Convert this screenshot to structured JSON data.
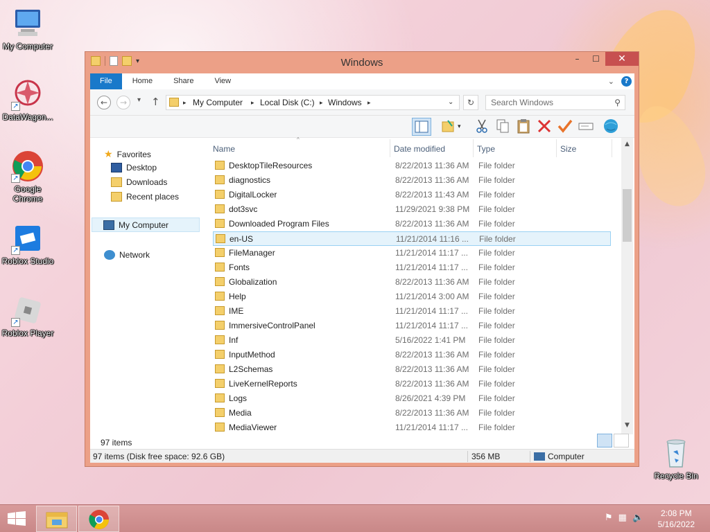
{
  "desktop": {
    "icons": [
      {
        "label": "My Computer"
      },
      {
        "label": "DataWagon..."
      },
      {
        "label": "Google Chrome"
      },
      {
        "label": "Roblox Studio"
      },
      {
        "label": "Roblox Player"
      },
      {
        "label": "Recycle Bin"
      }
    ]
  },
  "window": {
    "title": "Windows",
    "controls": {
      "minimize": "–",
      "maximize": "☐",
      "close": "✕"
    },
    "ribbon_tabs": [
      "File",
      "Home",
      "Share",
      "View"
    ],
    "address": {
      "segments": [
        "My Computer",
        "Local Disk (C:)",
        "Windows"
      ]
    },
    "search": {
      "placeholder": "Search Windows"
    },
    "nav": {
      "favorites": "Favorites",
      "favorites_items": [
        "Desktop",
        "Downloads",
        "Recent places"
      ],
      "my_computer": "My Computer",
      "network": "Network"
    },
    "columns": [
      "Name",
      "Date modified",
      "Type",
      "Size"
    ],
    "files": [
      {
        "name": "DesktopTileResources",
        "date": "8/22/2013 11:36 AM",
        "type": "File folder"
      },
      {
        "name": "diagnostics",
        "date": "8/22/2013 11:36 AM",
        "type": "File folder"
      },
      {
        "name": "DigitalLocker",
        "date": "8/22/2013 11:43 AM",
        "type": "File folder"
      },
      {
        "name": "dot3svc",
        "date": "11/29/2021 9:38 PM",
        "type": "File folder"
      },
      {
        "name": "Downloaded Program Files",
        "date": "8/22/2013 11:36 AM",
        "type": "File folder"
      },
      {
        "name": "en-US",
        "date": "11/21/2014 11:16 ...",
        "type": "File folder",
        "selected": true
      },
      {
        "name": "FileManager",
        "date": "11/21/2014 11:17 ...",
        "type": "File folder"
      },
      {
        "name": "Fonts",
        "date": "11/21/2014 11:17 ...",
        "type": "File folder"
      },
      {
        "name": "Globalization",
        "date": "8/22/2013 11:36 AM",
        "type": "File folder"
      },
      {
        "name": "Help",
        "date": "11/21/2014 3:00 AM",
        "type": "File folder"
      },
      {
        "name": "IME",
        "date": "11/21/2014 11:17 ...",
        "type": "File folder"
      },
      {
        "name": "ImmersiveControlPanel",
        "date": "11/21/2014 11:17 ...",
        "type": "File folder"
      },
      {
        "name": "Inf",
        "date": "5/16/2022 1:41 PM",
        "type": "File folder"
      },
      {
        "name": "InputMethod",
        "date": "8/22/2013 11:36 AM",
        "type": "File folder"
      },
      {
        "name": "L2Schemas",
        "date": "8/22/2013 11:36 AM",
        "type": "File folder"
      },
      {
        "name": "LiveKernelReports",
        "date": "8/22/2013 11:36 AM",
        "type": "File folder"
      },
      {
        "name": "Logs",
        "date": "8/26/2021 4:39 PM",
        "type": "File folder"
      },
      {
        "name": "Media",
        "date": "8/22/2013 11:36 AM",
        "type": "File folder"
      },
      {
        "name": "MediaViewer",
        "date": "11/21/2014 11:17 ...",
        "type": "File folder"
      }
    ],
    "item_count": "97 items",
    "status": {
      "left": "97 items (Disk free space: 92.6 GB)",
      "size": "356 MB",
      "location": "Computer"
    }
  },
  "taskbar": {
    "time": "2:08 PM",
    "date": "5/16/2022"
  },
  "colors": {
    "accent": "#1979ca",
    "window_frame": "#eca087",
    "close_button": "#c75050",
    "selection": "#e5f3fb"
  }
}
